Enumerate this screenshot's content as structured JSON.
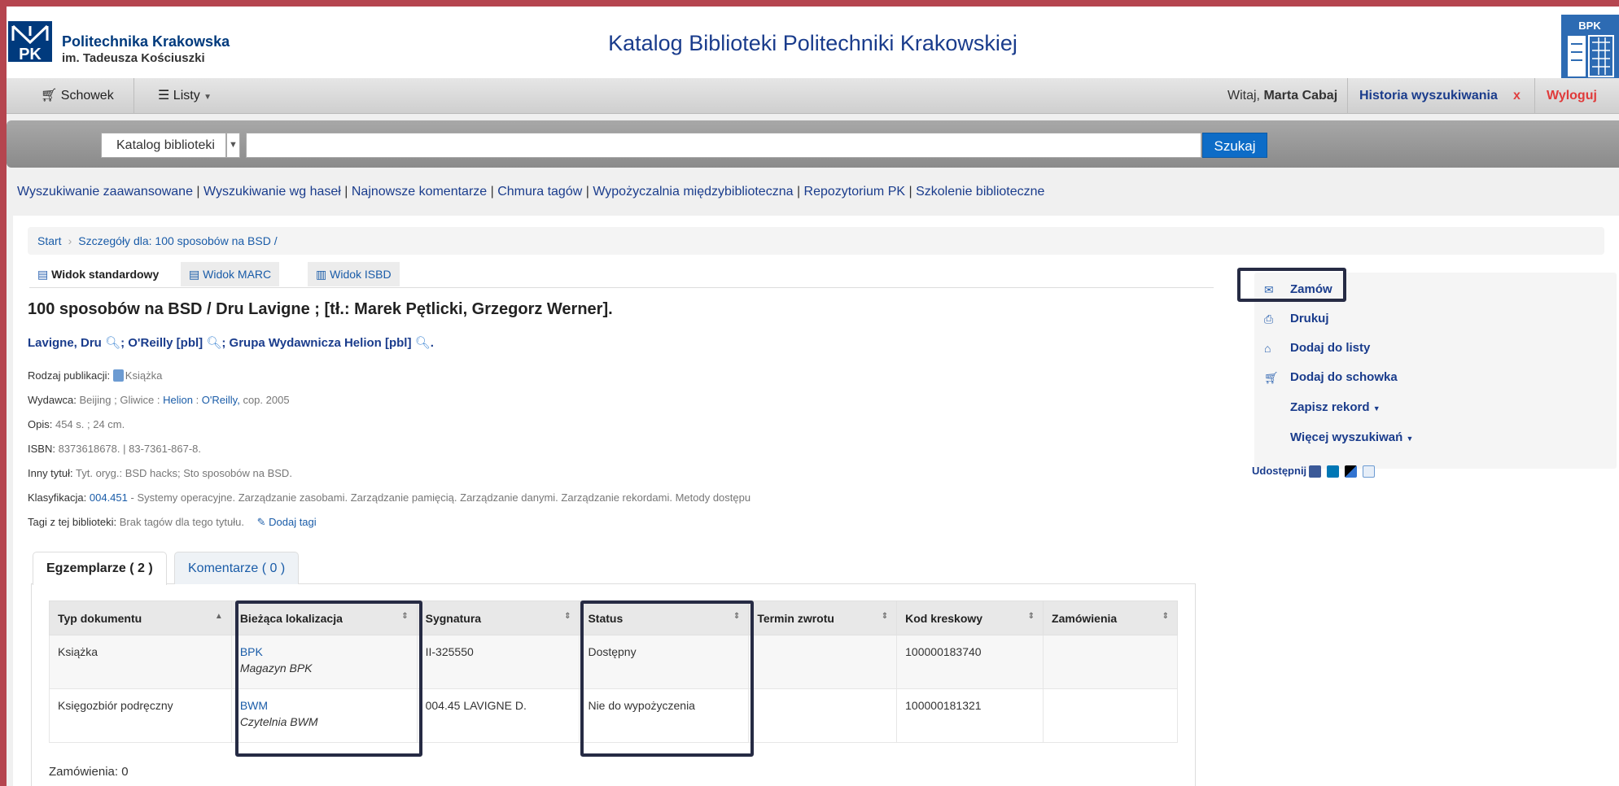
{
  "header": {
    "university_name": "Politechnika Krakowska",
    "university_subname": "im. Tadeusza Kościuszki",
    "pk_logo_text": "PK",
    "catalog_title": "Katalog Biblioteki Politechniki Krakowskiej",
    "bpk_logo_text": "BPK"
  },
  "nav": {
    "clipboard": "Schowek",
    "lists": "Listy",
    "welcome": "Witaj,",
    "user": "Marta Cabaj",
    "history": "Historia wyszukiwania",
    "history_clear": "x",
    "logout": "Wyloguj"
  },
  "search": {
    "scope": "Katalog biblioteki",
    "query": "",
    "button": "Szukaj"
  },
  "links": [
    "Wyszukiwanie zaawansowane",
    "Wyszukiwanie wg haseł",
    "Najnowsze komentarze",
    "Chmura tagów",
    "Wypożyczalnia międzybiblioteczna",
    "Repozytorium PK",
    "Szkolenie biblioteczne"
  ],
  "breadcrumb": {
    "start": "Start",
    "details": "Szczegóły dla: 100 sposobów na BSD /"
  },
  "view_tabs": [
    "Widok standardowy",
    "Widok MARC",
    "Widok ISBD"
  ],
  "record": {
    "title": "100 sposobów na BSD / Dru Lavigne ; [tł.: Marek Pętlicki, Grzegorz Werner].",
    "author1": "Lavigne, Dru",
    "author2": "O'Reilly [pbl]",
    "author3": "Grupa Wydawnicza Helion [pbl]",
    "type_label": "Rodzaj publikacji:",
    "type_value": "Książka",
    "publisher_label": "Wydawca:",
    "publisher_place": "Beijing ; Gliwice :",
    "publisher_1": "Helion",
    "publisher_2": "O'Reilly,",
    "publisher_year": "cop. 2005",
    "desc_label": "Opis:",
    "desc_value": "454 s. ; 24 cm.",
    "isbn_label": "ISBN:",
    "isbn_value": "8373618678. | 83-7361-867-8.",
    "other_title_label": "Inny tytuł:",
    "other_title_value": "Tyt. oryg.: BSD hacks; Sto sposobów na BSD.",
    "class_label": "Klasyfikacja:",
    "class_code": "004.451",
    "class_value": "- Systemy operacyjne. Zarządzanie zasobami. Zarządzanie pamięcią. Zarządzanie danymi. Zarządzanie rekordami. Metody dostępu",
    "tags_label": "Tagi z tej biblioteki:",
    "tags_value": "Brak tagów dla tego tytułu.",
    "add_tags": "Dodaj tagi"
  },
  "holdings_tabs": [
    "Egzemplarze ( 2 )",
    "Komentarze ( 0 )"
  ],
  "items_table": {
    "headers": [
      "Typ dokumentu",
      "Bieżąca lokalizacja",
      "Sygnatura",
      "Status",
      "Termin zwrotu",
      "Kod kreskowy",
      "Zamówienia"
    ],
    "rows": [
      {
        "type": "Książka",
        "loc": "BPK",
        "loc_sub": "Magazyn BPK",
        "call": "II-325550",
        "status": "Dostępny",
        "due": "",
        "barcode": "100000183740",
        "holds": ""
      },
      {
        "type": "Księgozbiór podręczny",
        "loc": "BWM",
        "loc_sub": "Czytelnia BWM",
        "call": "004.45 LAVIGNE D.",
        "status": "Nie do wypożyczenia",
        "due": "",
        "barcode": "100000181321",
        "holds": ""
      }
    ]
  },
  "reservations": "Zamówienia: 0",
  "sidebar": {
    "order": "Zamów",
    "print": "Drukuj",
    "add_list": "Dodaj do listy",
    "add_cart": "Dodaj do schowka",
    "save": "Zapisz rekord",
    "more": "Więcej wyszukiwań",
    "share": "Udostępnij"
  }
}
